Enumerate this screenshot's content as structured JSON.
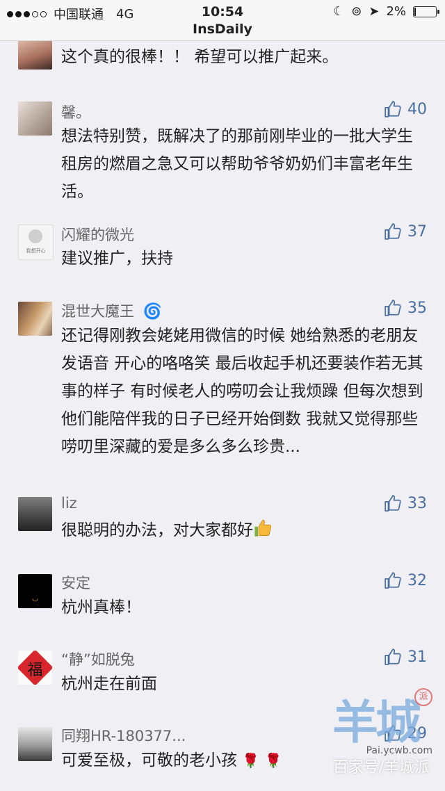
{
  "status_bar": {
    "carrier": "中国联通",
    "network": "4G",
    "time": "10:54",
    "battery": "2%",
    "app_title": "InsDaily"
  },
  "comments": [
    {
      "name": "",
      "text": "这个真的很棒！！ 希望可以推广起来。",
      "likes": ""
    },
    {
      "name": "馨。",
      "text": "想法特别赞，既解决了的那前刚毕业的一批大学生租房的燃眉之急又可以帮助爷爷奶奶们丰富老年生活。",
      "likes": "40"
    },
    {
      "name": "闪耀的微光",
      "text": "建议推广，扶持",
      "likes": "37",
      "avatar_text": "我想开心"
    },
    {
      "name": "混世大魔王",
      "text": "还记得刚教会姥姥用微信的时候 她给熟悉的老朋友发语音 开心的咯咯笑 最后收起手机还要装作若无其事的样子 有时候老人的唠叨会让我烦躁 但每次想到他们能陪伴我的日子已经开始倒数 我就又觉得那些唠叨里深藏的爱是多么多么珍贵...",
      "likes": "35"
    },
    {
      "name": "liz",
      "text": "很聪明的办法，对大家都好",
      "likes": "33"
    },
    {
      "name": "安定",
      "text": "杭州真棒！",
      "likes": "32"
    },
    {
      "name": "“静”如脱兔",
      "text": "杭州走在前面",
      "likes": "31",
      "avatar_text": "福"
    },
    {
      "name": "同翔HR-180377...",
      "text": "可爱至极，可敬的老小孩",
      "likes": "29"
    }
  ],
  "watermark": {
    "brand": "羊城",
    "seal": "派",
    "site": "Pai.ycwb.com",
    "footer": "百家号/羊城派"
  },
  "colors": {
    "like_blue": "#4a6f9e",
    "background": "#efeff4"
  }
}
